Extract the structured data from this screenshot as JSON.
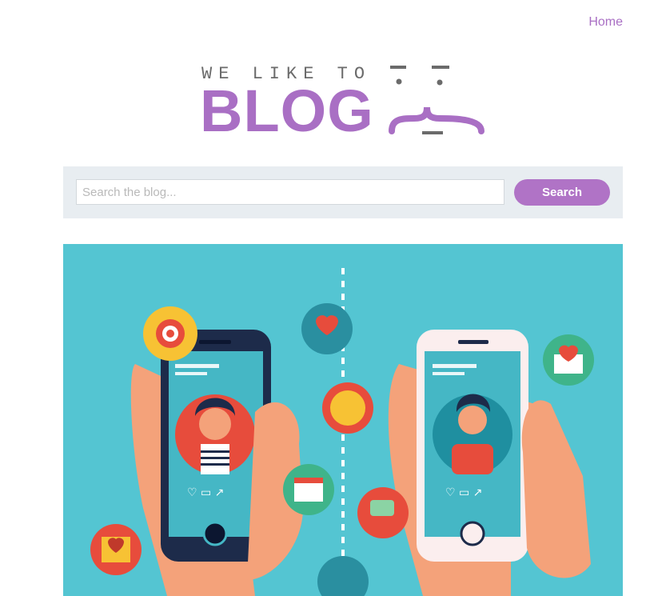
{
  "nav": {
    "home_label": "Home"
  },
  "logo": {
    "tagline": "WE LIKE TO",
    "wordmark": "BLOG"
  },
  "search": {
    "placeholder": "Search the blog...",
    "value": "",
    "button_label": "Search"
  },
  "hero": {
    "image_description": "illustration",
    "background_color": "#54c5d2"
  },
  "colors": {
    "accent": "#a96fc4",
    "search_bar_bg": "#e8edf1",
    "hero_bg": "#54c5d2"
  }
}
